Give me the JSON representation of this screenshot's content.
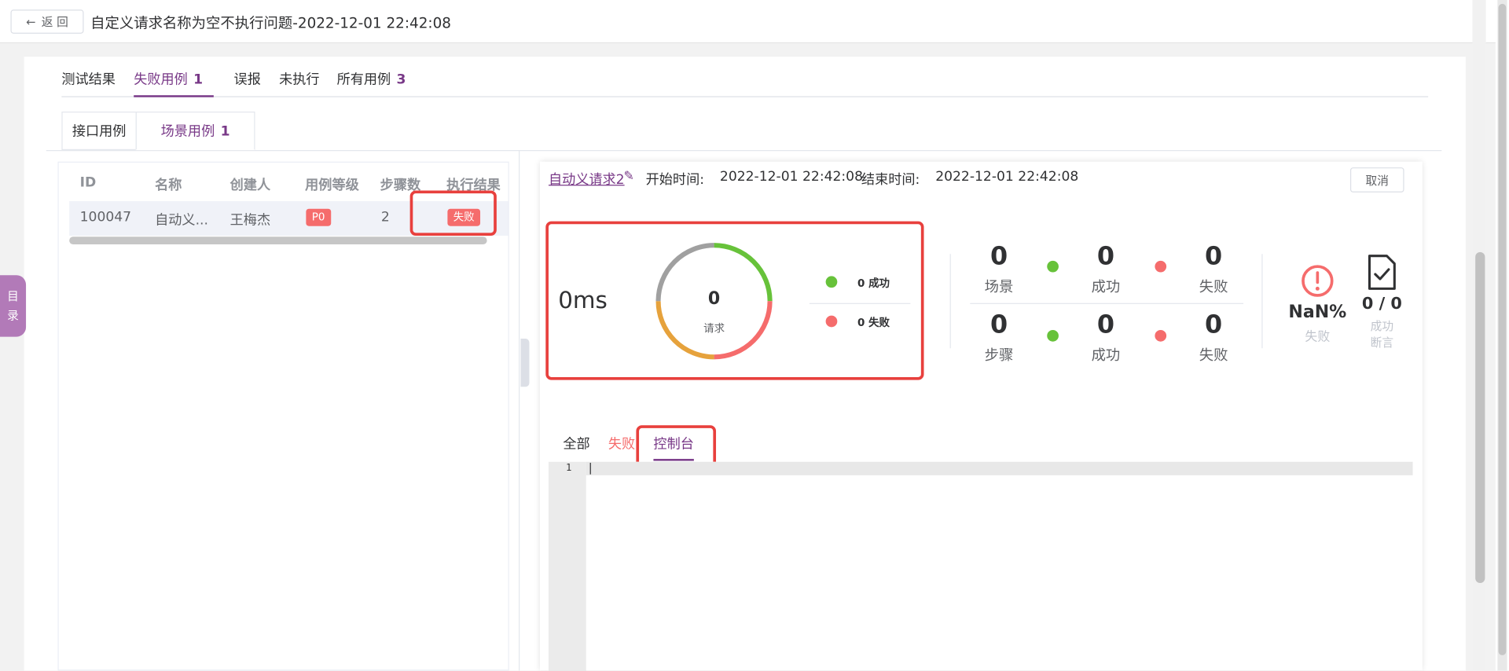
{
  "header": {
    "back_label": "返 回",
    "title": "自定义请求名称为空不执行问题-2022-12-01 22:42:08"
  },
  "result_tabs": [
    {
      "label": "测试结果",
      "count": ""
    },
    {
      "label": "失败用例",
      "count": "1"
    },
    {
      "label": "误报",
      "count": ""
    },
    {
      "label": "未执行",
      "count": ""
    },
    {
      "label": "所有用例",
      "count": "3"
    }
  ],
  "case_tabs": [
    {
      "label": "接口用例",
      "count": ""
    },
    {
      "label": "场景用例",
      "count": "1"
    }
  ],
  "side_tab": {
    "label_line1": "目",
    "label_line2": "录"
  },
  "table": {
    "headers": [
      "ID",
      "名称",
      "创建人",
      "用例等级",
      "步骤数",
      "执行结果"
    ],
    "rows": [
      {
        "id": "100047",
        "name": "自动义...",
        "creator": "王梅杰",
        "level": "P0",
        "steps": "2",
        "result": "失败"
      }
    ]
  },
  "detail": {
    "scenario_name": "自动义请求2",
    "start_label": "开始时间:",
    "start_time": "2022-12-01 22:42:08",
    "end_label": "结束时间:",
    "end_time": "2022-12-01 22:42:08",
    "cancel_label": "取消",
    "duration": "0ms",
    "requests": {
      "count": "0",
      "label": "请求"
    },
    "legend": {
      "success": "0 成功",
      "fail": "0 失败"
    },
    "scenario_stats": {
      "total": "0",
      "total_label": "场景",
      "success": "0",
      "success_label": "成功",
      "fail": "0",
      "fail_label": "失败"
    },
    "step_stats": {
      "total": "0",
      "total_label": "步骤",
      "success": "0",
      "success_label": "成功",
      "fail": "0",
      "fail_label": "失败"
    },
    "fail_rate": {
      "value": "NaN%",
      "label": "失败"
    },
    "assertions": {
      "value": "0 / 0",
      "label_line1": "成功",
      "label_line2": "断言"
    }
  },
  "bottom_tabs": [
    "全部",
    "失败",
    "控制台"
  ],
  "editor": {
    "line_number": "1"
  },
  "colors": {
    "brand": "#783887",
    "success": "#67c23a",
    "fail": "#f56c6c",
    "warning": "#e6a23c",
    "highlight": "#e8403d"
  }
}
